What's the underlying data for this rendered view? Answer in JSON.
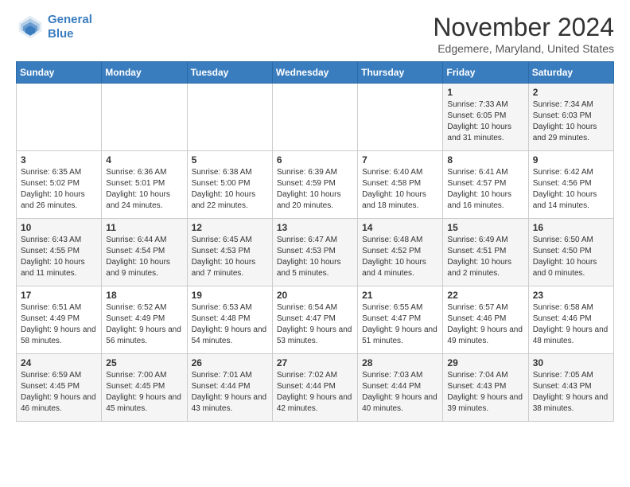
{
  "header": {
    "logo_line1": "General",
    "logo_line2": "Blue",
    "month_title": "November 2024",
    "subtitle": "Edgemere, Maryland, United States"
  },
  "weekdays": [
    "Sunday",
    "Monday",
    "Tuesday",
    "Wednesday",
    "Thursday",
    "Friday",
    "Saturday"
  ],
  "weeks": [
    [
      {
        "day": "",
        "text": ""
      },
      {
        "day": "",
        "text": ""
      },
      {
        "day": "",
        "text": ""
      },
      {
        "day": "",
        "text": ""
      },
      {
        "day": "",
        "text": ""
      },
      {
        "day": "1",
        "text": "Sunrise: 7:33 AM\nSunset: 6:05 PM\nDaylight: 10 hours and 31 minutes."
      },
      {
        "day": "2",
        "text": "Sunrise: 7:34 AM\nSunset: 6:03 PM\nDaylight: 10 hours and 29 minutes."
      }
    ],
    [
      {
        "day": "3",
        "text": "Sunrise: 6:35 AM\nSunset: 5:02 PM\nDaylight: 10 hours and 26 minutes."
      },
      {
        "day": "4",
        "text": "Sunrise: 6:36 AM\nSunset: 5:01 PM\nDaylight: 10 hours and 24 minutes."
      },
      {
        "day": "5",
        "text": "Sunrise: 6:38 AM\nSunset: 5:00 PM\nDaylight: 10 hours and 22 minutes."
      },
      {
        "day": "6",
        "text": "Sunrise: 6:39 AM\nSunset: 4:59 PM\nDaylight: 10 hours and 20 minutes."
      },
      {
        "day": "7",
        "text": "Sunrise: 6:40 AM\nSunset: 4:58 PM\nDaylight: 10 hours and 18 minutes."
      },
      {
        "day": "8",
        "text": "Sunrise: 6:41 AM\nSunset: 4:57 PM\nDaylight: 10 hours and 16 minutes."
      },
      {
        "day": "9",
        "text": "Sunrise: 6:42 AM\nSunset: 4:56 PM\nDaylight: 10 hours and 14 minutes."
      }
    ],
    [
      {
        "day": "10",
        "text": "Sunrise: 6:43 AM\nSunset: 4:55 PM\nDaylight: 10 hours and 11 minutes."
      },
      {
        "day": "11",
        "text": "Sunrise: 6:44 AM\nSunset: 4:54 PM\nDaylight: 10 hours and 9 minutes."
      },
      {
        "day": "12",
        "text": "Sunrise: 6:45 AM\nSunset: 4:53 PM\nDaylight: 10 hours and 7 minutes."
      },
      {
        "day": "13",
        "text": "Sunrise: 6:47 AM\nSunset: 4:53 PM\nDaylight: 10 hours and 5 minutes."
      },
      {
        "day": "14",
        "text": "Sunrise: 6:48 AM\nSunset: 4:52 PM\nDaylight: 10 hours and 4 minutes."
      },
      {
        "day": "15",
        "text": "Sunrise: 6:49 AM\nSunset: 4:51 PM\nDaylight: 10 hours and 2 minutes."
      },
      {
        "day": "16",
        "text": "Sunrise: 6:50 AM\nSunset: 4:50 PM\nDaylight: 10 hours and 0 minutes."
      }
    ],
    [
      {
        "day": "17",
        "text": "Sunrise: 6:51 AM\nSunset: 4:49 PM\nDaylight: 9 hours and 58 minutes."
      },
      {
        "day": "18",
        "text": "Sunrise: 6:52 AM\nSunset: 4:49 PM\nDaylight: 9 hours and 56 minutes."
      },
      {
        "day": "19",
        "text": "Sunrise: 6:53 AM\nSunset: 4:48 PM\nDaylight: 9 hours and 54 minutes."
      },
      {
        "day": "20",
        "text": "Sunrise: 6:54 AM\nSunset: 4:47 PM\nDaylight: 9 hours and 53 minutes."
      },
      {
        "day": "21",
        "text": "Sunrise: 6:55 AM\nSunset: 4:47 PM\nDaylight: 9 hours and 51 minutes."
      },
      {
        "day": "22",
        "text": "Sunrise: 6:57 AM\nSunset: 4:46 PM\nDaylight: 9 hours and 49 minutes."
      },
      {
        "day": "23",
        "text": "Sunrise: 6:58 AM\nSunset: 4:46 PM\nDaylight: 9 hours and 48 minutes."
      }
    ],
    [
      {
        "day": "24",
        "text": "Sunrise: 6:59 AM\nSunset: 4:45 PM\nDaylight: 9 hours and 46 minutes."
      },
      {
        "day": "25",
        "text": "Sunrise: 7:00 AM\nSunset: 4:45 PM\nDaylight: 9 hours and 45 minutes."
      },
      {
        "day": "26",
        "text": "Sunrise: 7:01 AM\nSunset: 4:44 PM\nDaylight: 9 hours and 43 minutes."
      },
      {
        "day": "27",
        "text": "Sunrise: 7:02 AM\nSunset: 4:44 PM\nDaylight: 9 hours and 42 minutes."
      },
      {
        "day": "28",
        "text": "Sunrise: 7:03 AM\nSunset: 4:44 PM\nDaylight: 9 hours and 40 minutes."
      },
      {
        "day": "29",
        "text": "Sunrise: 7:04 AM\nSunset: 4:43 PM\nDaylight: 9 hours and 39 minutes."
      },
      {
        "day": "30",
        "text": "Sunrise: 7:05 AM\nSunset: 4:43 PM\nDaylight: 9 hours and 38 minutes."
      }
    ]
  ]
}
